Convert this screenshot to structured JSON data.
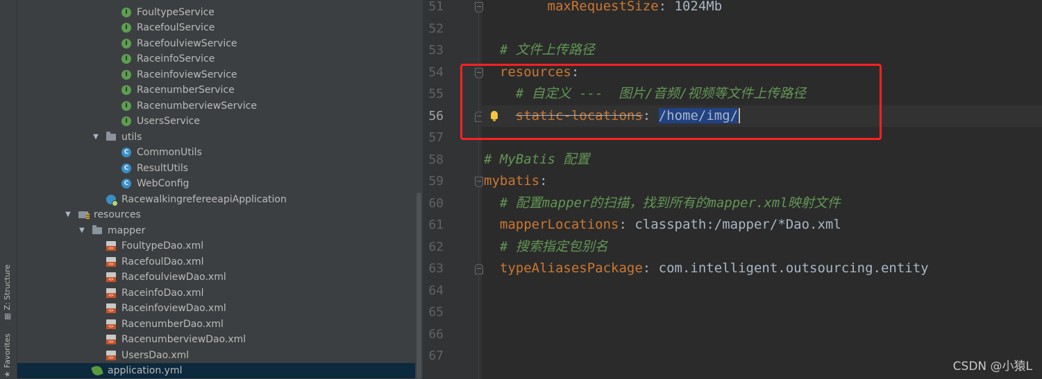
{
  "tool_tabs": [
    {
      "label": "Z: Structure",
      "icon": "structure-icon"
    },
    {
      "label": "Favorites",
      "icon": "star-icon"
    }
  ],
  "tree": {
    "rows": [
      {
        "label": "FoultypeService",
        "icon": "interface",
        "depth": 3
      },
      {
        "label": "RacefoulService",
        "icon": "interface",
        "depth": 3
      },
      {
        "label": "RacefoulviewService",
        "icon": "interface",
        "depth": 3
      },
      {
        "label": "RaceinfoService",
        "icon": "interface",
        "depth": 3
      },
      {
        "label": "RaceinfoviewService",
        "icon": "interface",
        "depth": 3
      },
      {
        "label": "RacenumberService",
        "icon": "interface",
        "depth": 3
      },
      {
        "label": "RacenumberviewService",
        "icon": "interface",
        "depth": 3
      },
      {
        "label": "UsersService",
        "icon": "interface",
        "depth": 3
      },
      {
        "label": "utils",
        "icon": "folder",
        "depth": 2,
        "expanded": true
      },
      {
        "label": "CommonUtils",
        "icon": "class",
        "depth": 3
      },
      {
        "label": "ResultUtils",
        "icon": "class",
        "depth": 3
      },
      {
        "label": "WebConfig",
        "icon": "class",
        "depth": 3
      },
      {
        "label": "RacewalkingrefereeapiApplication",
        "icon": "app",
        "depth": 2
      },
      {
        "label": "resources",
        "icon": "resources",
        "depth": 0,
        "expanded": true
      },
      {
        "label": "mapper",
        "icon": "folder",
        "depth": 1,
        "expanded": true
      },
      {
        "label": "FoultypeDao.xml",
        "icon": "xml",
        "depth": 2
      },
      {
        "label": "RacefoulDao.xml",
        "icon": "xml",
        "depth": 2
      },
      {
        "label": "RacefoulviewDao.xml",
        "icon": "xml",
        "depth": 2
      },
      {
        "label": "RaceinfoDao.xml",
        "icon": "xml",
        "depth": 2
      },
      {
        "label": "RaceinfoviewDao.xml",
        "icon": "xml",
        "depth": 2
      },
      {
        "label": "RacenumberDao.xml",
        "icon": "xml",
        "depth": 2
      },
      {
        "label": "RacenumberviewDao.xml",
        "icon": "xml",
        "depth": 2
      },
      {
        "label": "UsersDao.xml",
        "icon": "xml",
        "depth": 2
      },
      {
        "label": "application.yml",
        "icon": "yml",
        "depth": 1,
        "selected": true
      }
    ]
  },
  "editor": {
    "lines": [
      {
        "num": "51",
        "parts": [
          {
            "t": "maxRequestSize",
            "s": "k"
          },
          {
            "t": ": 1024Mb",
            "s": "v"
          }
        ],
        "indent": "        "
      },
      {
        "num": "52",
        "parts": [],
        "indent": ""
      },
      {
        "num": "53",
        "parts": [
          {
            "t": "# 文件上传路径",
            "s": "c"
          }
        ],
        "indent": "  "
      },
      {
        "num": "54",
        "parts": [
          {
            "t": "resources",
            "s": "k"
          },
          {
            "t": ":",
            "s": "v"
          }
        ],
        "indent": "  "
      },
      {
        "num": "55",
        "parts": [
          {
            "t": "# 自定义 ---  图片/音频/视频等文件上传路径",
            "s": "c"
          }
        ],
        "indent": "    "
      },
      {
        "num": "56",
        "parts": [
          {
            "t": "static-locations",
            "s": "dep"
          },
          {
            "t": ": ",
            "s": "v"
          },
          {
            "t": "/home/img/",
            "s": "sel"
          }
        ],
        "indent": "    ",
        "current": true
      },
      {
        "num": "57",
        "parts": [],
        "indent": ""
      },
      {
        "num": "58",
        "parts": [
          {
            "t": "# MyBatis 配置",
            "s": "c"
          }
        ],
        "indent": ""
      },
      {
        "num": "59",
        "parts": [
          {
            "t": "mybatis",
            "s": "k"
          },
          {
            "t": ":",
            "s": "v"
          }
        ],
        "indent": ""
      },
      {
        "num": "60",
        "parts": [
          {
            "t": "# 配置mapper的扫描，找到所有的mapper.xml映射文件",
            "s": "c"
          }
        ],
        "indent": "  "
      },
      {
        "num": "61",
        "parts": [
          {
            "t": "mapperLocations",
            "s": "k"
          },
          {
            "t": ": classpath:/mapper/*Dao.xml",
            "s": "v"
          }
        ],
        "indent": "  "
      },
      {
        "num": "62",
        "parts": [
          {
            "t": "# 搜索指定包别名",
            "s": "c"
          }
        ],
        "indent": "  "
      },
      {
        "num": "63",
        "parts": [
          {
            "t": "typeAliasesPackage",
            "s": "k"
          },
          {
            "t": ": com.intelligent.outsourcing.entity",
            "s": "v"
          }
        ],
        "indent": "  "
      },
      {
        "num": "64",
        "parts": [],
        "indent": ""
      },
      {
        "num": "65",
        "parts": [],
        "indent": ""
      },
      {
        "num": "66",
        "parts": [],
        "indent": ""
      },
      {
        "num": "67",
        "parts": [],
        "indent": ""
      }
    ],
    "fold_markers": [
      "51",
      "54",
      "56",
      "59",
      "63"
    ]
  },
  "watermark": "CSDN @小猿L",
  "colors": {
    "keyword": "#cc7832",
    "comment": "#629755",
    "value": "#a9b7c6",
    "selection": "#214283",
    "highlight_box": "#ff2222"
  }
}
